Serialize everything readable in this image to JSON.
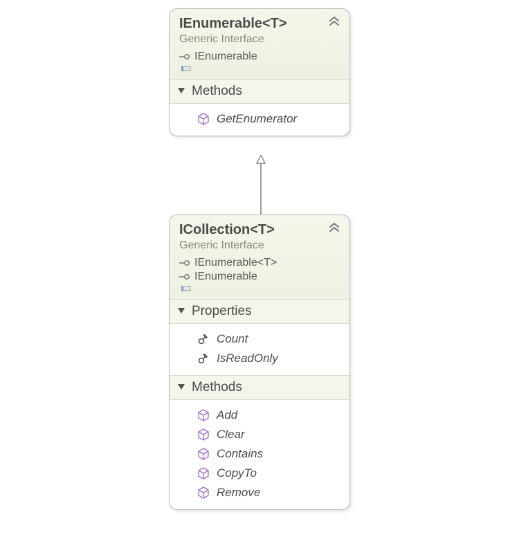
{
  "boxes": {
    "ienumerable": {
      "title": "IEnumerable<T>",
      "subtitle": "Generic Interface",
      "bases": [
        "IEnumerable"
      ],
      "sections": {
        "methods": {
          "label": "Methods",
          "items": [
            "GetEnumerator"
          ]
        }
      }
    },
    "icollection": {
      "title": "ICollection<T>",
      "subtitle": "Generic Interface",
      "bases": [
        "IEnumerable<T>",
        "IEnumerable"
      ],
      "sections": {
        "properties": {
          "label": "Properties",
          "items": [
            "Count",
            "IsReadOnly"
          ]
        },
        "methods": {
          "label": "Methods",
          "items": [
            "Add",
            "Clear",
            "Contains",
            "CopyTo",
            "Remove"
          ]
        }
      }
    }
  },
  "relation": {
    "from": "ICollection<T>",
    "to": "IEnumerable<T>",
    "type": "implements"
  }
}
